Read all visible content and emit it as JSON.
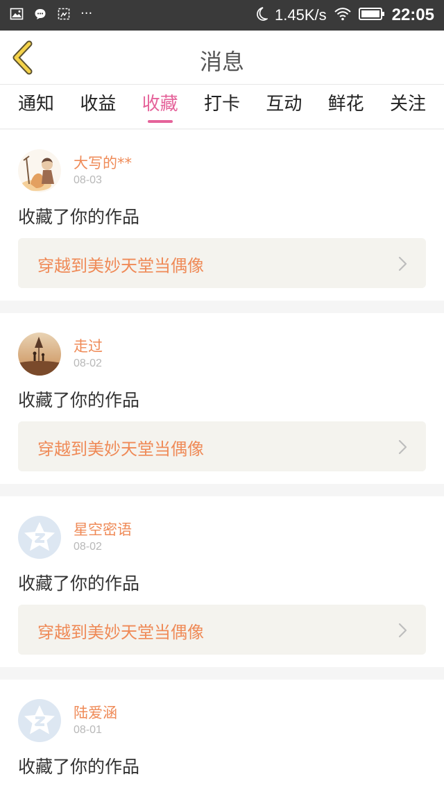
{
  "status_bar": {
    "net_speed": "1.45K/s",
    "time": "22:05",
    "dots": "···",
    "icons": [
      "image-icon",
      "chat-icon",
      "screenshot-icon",
      "moon-icon",
      "wifi-icon",
      "battery-icon"
    ]
  },
  "header": {
    "title": "消息",
    "back_icon": "chevron-left-icon"
  },
  "tabs": [
    {
      "label": "通知"
    },
    {
      "label": "收益"
    },
    {
      "label": "收藏",
      "active": true
    },
    {
      "label": "打卡"
    },
    {
      "label": "互动"
    },
    {
      "label": "鲜花"
    },
    {
      "label": "关注"
    }
  ],
  "feed": [
    {
      "user": "大写的**",
      "date": "08-03",
      "action": "收藏了你的作品",
      "work_title": "穿越到美妙天堂当偶像",
      "avatar": "illustration-avatar"
    },
    {
      "user": "走过",
      "date": "08-02",
      "action": "收藏了你的作品",
      "work_title": "穿越到美妙天堂当偶像",
      "avatar": "photo-avatar"
    },
    {
      "user": "星空密语",
      "date": "08-02",
      "action": "收藏了你的作品",
      "work_title": "穿越到美妙天堂当偶像",
      "avatar": "default-qq-avatar"
    },
    {
      "user": "陆爱涵",
      "date": "08-01",
      "action": "收藏了你的作品",
      "avatar": "default-qq-avatar"
    }
  ],
  "colors": {
    "accent": "#e5639a",
    "orange": "#ef8a57",
    "status_bar": "#3a3a3a"
  }
}
